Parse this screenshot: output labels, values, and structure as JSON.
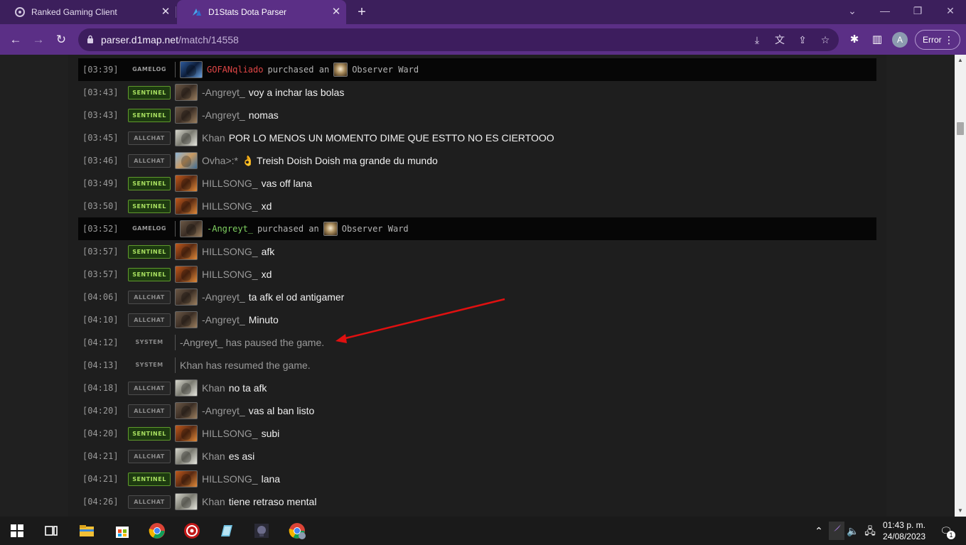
{
  "browser": {
    "tabs": [
      {
        "title": "Ranked Gaming Client",
        "icon": "gaming-client-icon",
        "active": false
      },
      {
        "title": "D1Stats Dota Parser",
        "icon": "d1stats-icon",
        "active": true
      }
    ],
    "url": {
      "domain": "parser.d1map.net",
      "path": "/match/14558"
    },
    "profile_initial": "A",
    "error_label": "Error",
    "theme_color": "#5b2f86"
  },
  "log": [
    {
      "time": "[03:39]",
      "channel": "GAMELOG",
      "type": "gamelog",
      "player": "GOFANqliado",
      "player_color": "#e04646",
      "hero": "h-gofan",
      "action": "purchased an",
      "item": "Observer Ward"
    },
    {
      "time": "[03:43]",
      "channel": "SENTINEL",
      "type": "sentinel",
      "player": "-Angreyt_",
      "hero": "h-angreyt",
      "message": "voy a inchar las bolas"
    },
    {
      "time": "[03:43]",
      "channel": "SENTINEL",
      "type": "sentinel",
      "player": "-Angreyt_",
      "hero": "h-angreyt",
      "message": "nomas"
    },
    {
      "time": "[03:45]",
      "channel": "ALLCHAT",
      "type": "allchat",
      "player": "Khan",
      "hero": "h-khan",
      "message": "POR LO MENOS UN MOMENTO DIME QUE ESTTO NO ES CIERTOOO"
    },
    {
      "time": "[03:46]",
      "channel": "ALLCHAT",
      "type": "allchat",
      "player": "Ovha>:*",
      "hero": "h-ovha",
      "message": "👌 Treish Doish Doish ma grande du mundo"
    },
    {
      "time": "[03:49]",
      "channel": "SENTINEL",
      "type": "sentinel",
      "player": "HILLSONG_",
      "hero": "h-hill",
      "message": "vas off lana"
    },
    {
      "time": "[03:50]",
      "channel": "SENTINEL",
      "type": "sentinel",
      "player": "HILLSONG_",
      "hero": "h-hill",
      "message": "xd"
    },
    {
      "time": "[03:52]",
      "channel": "GAMELOG",
      "type": "gamelog",
      "player": "-Angreyt_",
      "player_color": "#7fd060",
      "hero": "h-angreyt",
      "action": "purchased an",
      "item": "Observer Ward"
    },
    {
      "time": "[03:57]",
      "channel": "SENTINEL",
      "type": "sentinel",
      "player": "HILLSONG_",
      "hero": "h-hill",
      "message": "afk"
    },
    {
      "time": "[03:57]",
      "channel": "SENTINEL",
      "type": "sentinel",
      "player": "HILLSONG_",
      "hero": "h-hill",
      "message": "xd"
    },
    {
      "time": "[04:06]",
      "channel": "ALLCHAT",
      "type": "allchat",
      "player": "-Angreyt_",
      "hero": "h-angreyt",
      "message": "ta afk el od antigamer"
    },
    {
      "time": "[04:10]",
      "channel": "ALLCHAT",
      "type": "allchat",
      "player": "-Angreyt_",
      "hero": "h-angreyt",
      "message": "Minuto"
    },
    {
      "time": "[04:12]",
      "channel": "SYSTEM",
      "type": "system",
      "text": "-Angreyt_ has paused the game."
    },
    {
      "time": "[04:13]",
      "channel": "SYSTEM",
      "type": "system",
      "text": "Khan has resumed the game."
    },
    {
      "time": "[04:18]",
      "channel": "ALLCHAT",
      "type": "allchat",
      "player": "Khan",
      "hero": "h-khan",
      "message": "no ta afk"
    },
    {
      "time": "[04:20]",
      "channel": "ALLCHAT",
      "type": "allchat",
      "player": "-Angreyt_",
      "hero": "h-angreyt",
      "message": "vas al ban listo"
    },
    {
      "time": "[04:20]",
      "channel": "SENTINEL",
      "type": "sentinel",
      "player": "HILLSONG_",
      "hero": "h-hill",
      "message": "subi"
    },
    {
      "time": "[04:21]",
      "channel": "ALLCHAT",
      "type": "allchat",
      "player": "Khan",
      "hero": "h-khan",
      "message": "es asi"
    },
    {
      "time": "[04:21]",
      "channel": "SENTINEL",
      "type": "sentinel",
      "player": "HILLSONG_",
      "hero": "h-hill",
      "message": "lana"
    },
    {
      "time": "[04:26]",
      "channel": "ALLCHAT",
      "type": "allchat",
      "player": "Khan",
      "hero": "h-khan",
      "message": "tiene retraso mental"
    }
  ],
  "annotation": {
    "color": "#e01010",
    "description": "red-arrow-pointing-at-pause-message"
  },
  "taskbar": {
    "time": "01:43 p. m.",
    "date": "24/08/2023",
    "notification_count": "1",
    "apps": [
      "start-icon",
      "task-view-icon",
      "file-explorer-icon",
      "store-icon",
      "chrome-icon",
      "ranked-client-icon",
      "notepad-icon",
      "game-icon",
      "chrome-profile-icon"
    ]
  }
}
